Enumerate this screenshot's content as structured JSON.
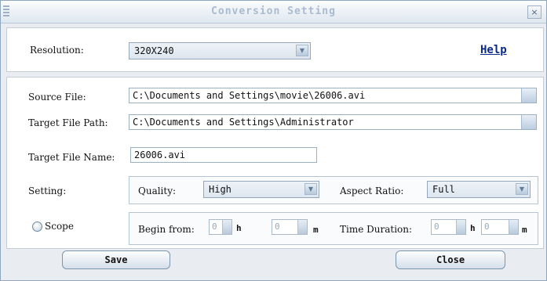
{
  "window": {
    "title": "Conversion Setting",
    "close_glyph": "×"
  },
  "resolution": {
    "label": "Resolution:",
    "value": "320X240",
    "help_link": "Help"
  },
  "source_file": {
    "label": "Source File:",
    "value": "C:\\Documents and Settings\\movie\\26006.avi"
  },
  "target_path": {
    "label": "Target File Path:",
    "value": "C:\\Documents and Settings\\Administrator"
  },
  "target_name": {
    "label": "Target File Name:",
    "value": "26006.avi"
  },
  "setting": {
    "label": "Setting:",
    "quality_label": "Quality:",
    "quality_value": "High",
    "aspect_label": "Aspect Ratio:",
    "aspect_value": "Full"
  },
  "scope": {
    "label": "Scope",
    "begin_label": "Begin from:",
    "begin_h": "0",
    "h_unit": "h",
    "begin_m": "0",
    "m_unit": "m",
    "duration_label": "Time Duration:",
    "dur_h": "0",
    "dur_h_unit": "h",
    "dur_m": "0",
    "dur_m_unit": "m"
  },
  "buttons": {
    "save": "Save",
    "close": "Close"
  },
  "icons": {
    "dropdown": "chevron-down-icon",
    "browse": "browse-icon",
    "close": "close-icon"
  },
  "colors": {
    "title_text": "#aabbd0",
    "link": "#0a2a8a",
    "border": "#95a7ba"
  }
}
